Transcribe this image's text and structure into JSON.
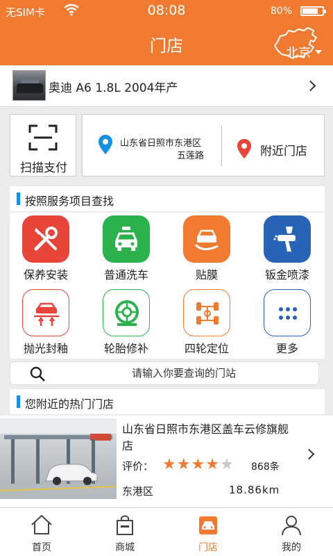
{
  "status_bar": {
    "carrier": "无SIM卡",
    "time": "08:08",
    "battery": "80%",
    "battery_level": 0.8
  },
  "header": {
    "title": "门店",
    "city": "北京"
  },
  "car": {
    "name": "奥迪 A6 1.8L 2004年产"
  },
  "actions": {
    "scan_pay": "扫描支付",
    "address_line1": "山东省日照市东港区",
    "address_line2": "五莲路",
    "nearby": "附近门店"
  },
  "services_section": {
    "title": "按照服务项目查找"
  },
  "services": [
    {
      "label": "保养安装",
      "icon": "wrench-screwdriver-icon",
      "color": "#e8453a"
    },
    {
      "label": "普通洗车",
      "icon": "car-wash-icon",
      "color": "#2bb24c"
    },
    {
      "label": "贴膜",
      "icon": "car-film-icon",
      "color": "#f07a30"
    },
    {
      "label": "钣金喷漆",
      "icon": "spray-gun-icon",
      "color": "#2763b7"
    },
    {
      "label": "抛光封釉",
      "icon": "car-lift-icon",
      "color": "#e8453a"
    },
    {
      "label": "轮胎修补",
      "icon": "tire-icon",
      "color": "#2bb24c"
    },
    {
      "label": "四轮定位",
      "icon": "wheel-alignment-icon",
      "color": "#f07a30"
    },
    {
      "label": "更多",
      "icon": "more-dots-icon",
      "color": "#2763b7"
    }
  ],
  "search": {
    "placeholder": "请输入你要查询的门站"
  },
  "hot_section": {
    "title": "您附近的热门门店"
  },
  "shop": {
    "name": "山东省日照市东港区盖车云修旗舰店",
    "rating_label": "评价：",
    "rating": 4,
    "rating_max": 5,
    "reviews": "868条",
    "district": "东港区",
    "distance": "18.86km"
  },
  "tabs": [
    {
      "label": "首页",
      "icon": "home-icon"
    },
    {
      "label": "商城",
      "icon": "shopping-bag-icon"
    },
    {
      "label": "门店",
      "icon": "store-icon",
      "active": true
    },
    {
      "label": "我的",
      "icon": "user-icon"
    }
  ],
  "colors": {
    "brand": "#f07a30",
    "accent": "#1690e0"
  }
}
